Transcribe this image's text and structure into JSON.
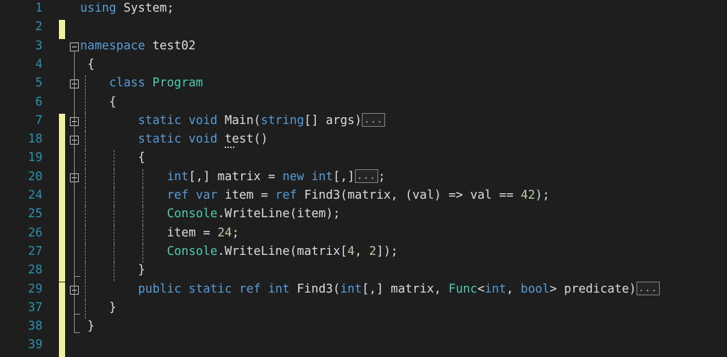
{
  "editor": {
    "language": "csharp",
    "background_color": "#1e1e1e",
    "line_number_color": "#2b91af",
    "change_bar_color": "#eef09a",
    "keyword_color": "#569cd6",
    "type_color": "#4ec9b0",
    "number_color": "#b5cea8",
    "text_color": "#dcdcdc",
    "collapsed_placeholder": "..."
  },
  "lines": [
    {
      "number": "1",
      "changed": false,
      "fold": "none",
      "indent_guides": 0,
      "tokens": [
        {
          "t": "using",
          "c": "kw"
        },
        {
          "t": " ",
          "c": "punc"
        },
        {
          "t": "System",
          "c": "id"
        },
        {
          "t": ";",
          "c": "punc"
        }
      ],
      "text": "using System;"
    },
    {
      "number": "2",
      "changed": true,
      "fold": "none",
      "indent_guides": 0,
      "tokens": [],
      "text": ""
    },
    {
      "number": "3",
      "changed": false,
      "fold": "minus",
      "indent_guides": 0,
      "tokens": [
        {
          "t": "namespace",
          "c": "kw"
        },
        {
          "t": " ",
          "c": "punc"
        },
        {
          "t": "test02",
          "c": "id"
        }
      ],
      "text": "namespace test02"
    },
    {
      "number": "4",
      "changed": false,
      "fold": "none",
      "indent_guides": 0,
      "tokens": [
        {
          "t": "{",
          "c": "punc"
        }
      ],
      "text": "{"
    },
    {
      "number": "5",
      "changed": false,
      "fold": "minus",
      "indent_guides": 1,
      "tokens": [
        {
          "t": "class",
          "c": "kw"
        },
        {
          "t": " ",
          "c": "punc"
        },
        {
          "t": "Program",
          "c": "typ"
        }
      ],
      "text": "class Program"
    },
    {
      "number": "6",
      "changed": false,
      "fold": "none",
      "indent_guides": 1,
      "tokens": [
        {
          "t": "{",
          "c": "punc"
        }
      ],
      "text": "{"
    },
    {
      "number": "7",
      "changed": true,
      "fold": "plus",
      "indent_guides": 1,
      "collapsed": true,
      "tokens": [
        {
          "t": "static",
          "c": "kw"
        },
        {
          "t": " ",
          "c": "punc"
        },
        {
          "t": "void",
          "c": "kw"
        },
        {
          "t": " ",
          "c": "punc"
        },
        {
          "t": "Main",
          "c": "id"
        },
        {
          "t": "(",
          "c": "punc"
        },
        {
          "t": "string",
          "c": "kw"
        },
        {
          "t": "[] ",
          "c": "punc"
        },
        {
          "t": "args",
          "c": "id"
        },
        {
          "t": ")",
          "c": "punc"
        }
      ],
      "text": "static void Main(string[] args)"
    },
    {
      "number": "18",
      "changed": true,
      "fold": "minus",
      "indent_guides": 1,
      "rename_hint": true,
      "tokens": [
        {
          "t": "static",
          "c": "kw"
        },
        {
          "t": " ",
          "c": "punc"
        },
        {
          "t": "void",
          "c": "kw"
        },
        {
          "t": " ",
          "c": "punc"
        },
        {
          "t": "test",
          "c": "id"
        },
        {
          "t": "()",
          "c": "punc"
        }
      ],
      "text": "static void test()"
    },
    {
      "number": "19",
      "changed": true,
      "fold": "none",
      "indent_guides": 2,
      "tokens": [
        {
          "t": "{",
          "c": "punc"
        }
      ],
      "text": "{"
    },
    {
      "number": "20",
      "changed": true,
      "fold": "plus",
      "indent_guides": 3,
      "collapsed": true,
      "collapsed_suffix": ";",
      "tokens": [
        {
          "t": "int",
          "c": "kw"
        },
        {
          "t": "[,] ",
          "c": "punc"
        },
        {
          "t": "matrix",
          "c": "id"
        },
        {
          "t": " = ",
          "c": "punc"
        },
        {
          "t": "new",
          "c": "kw"
        },
        {
          "t": " ",
          "c": "punc"
        },
        {
          "t": "int",
          "c": "kw"
        },
        {
          "t": "[,]",
          "c": "punc"
        }
      ],
      "text": "int[,] matrix = new int[,]"
    },
    {
      "number": "24",
      "changed": true,
      "fold": "none",
      "indent_guides": 3,
      "tokens": [
        {
          "t": "ref",
          "c": "kw"
        },
        {
          "t": " ",
          "c": "punc"
        },
        {
          "t": "var",
          "c": "kw"
        },
        {
          "t": " ",
          "c": "punc"
        },
        {
          "t": "item",
          "c": "id"
        },
        {
          "t": " = ",
          "c": "punc"
        },
        {
          "t": "ref",
          "c": "kw"
        },
        {
          "t": " ",
          "c": "punc"
        },
        {
          "t": "Find3",
          "c": "id"
        },
        {
          "t": "(",
          "c": "punc"
        },
        {
          "t": "matrix",
          "c": "id"
        },
        {
          "t": ", (",
          "c": "punc"
        },
        {
          "t": "val",
          "c": "id"
        },
        {
          "t": ") => ",
          "c": "punc"
        },
        {
          "t": "val",
          "c": "id"
        },
        {
          "t": " == ",
          "c": "punc"
        },
        {
          "t": "42",
          "c": "num"
        },
        {
          "t": ");",
          "c": "punc"
        }
      ],
      "text": "ref var item = ref Find3(matrix, (val) => val == 42);"
    },
    {
      "number": "25",
      "changed": true,
      "fold": "none",
      "indent_guides": 3,
      "tokens": [
        {
          "t": "Console",
          "c": "typ"
        },
        {
          "t": ".",
          "c": "punc"
        },
        {
          "t": "WriteLine",
          "c": "id"
        },
        {
          "t": "(",
          "c": "punc"
        },
        {
          "t": "item",
          "c": "id"
        },
        {
          "t": ");",
          "c": "punc"
        }
      ],
      "text": "Console.WriteLine(item);"
    },
    {
      "number": "26",
      "changed": true,
      "fold": "none",
      "indent_guides": 3,
      "tokens": [
        {
          "t": "item",
          "c": "id"
        },
        {
          "t": " = ",
          "c": "punc"
        },
        {
          "t": "24",
          "c": "num"
        },
        {
          "t": ";",
          "c": "punc"
        }
      ],
      "text": "item = 24;"
    },
    {
      "number": "27",
      "changed": true,
      "fold": "none",
      "indent_guides": 3,
      "tokens": [
        {
          "t": "Console",
          "c": "typ"
        },
        {
          "t": ".",
          "c": "punc"
        },
        {
          "t": "WriteLine",
          "c": "id"
        },
        {
          "t": "(",
          "c": "punc"
        },
        {
          "t": "matrix",
          "c": "id"
        },
        {
          "t": "[",
          "c": "punc"
        },
        {
          "t": "4",
          "c": "num"
        },
        {
          "t": ", ",
          "c": "punc"
        },
        {
          "t": "2",
          "c": "num"
        },
        {
          "t": "]);",
          "c": "punc"
        }
      ],
      "text": "Console.WriteLine(matrix[4, 2]);"
    },
    {
      "number": "28",
      "changed": true,
      "fold": "none",
      "indent_guides": 2,
      "tokens": [
        {
          "t": "}",
          "c": "punc"
        }
      ],
      "text": "}"
    },
    {
      "number": "29",
      "changed": true,
      "fold": "plus",
      "indent_guides": 1,
      "collapsed": true,
      "tokens": [
        {
          "t": "public",
          "c": "kw"
        },
        {
          "t": " ",
          "c": "punc"
        },
        {
          "t": "static",
          "c": "kw"
        },
        {
          "t": " ",
          "c": "punc"
        },
        {
          "t": "ref",
          "c": "kw"
        },
        {
          "t": " ",
          "c": "punc"
        },
        {
          "t": "int",
          "c": "kw"
        },
        {
          "t": " ",
          "c": "punc"
        },
        {
          "t": "Find3",
          "c": "id"
        },
        {
          "t": "(",
          "c": "punc"
        },
        {
          "t": "int",
          "c": "kw"
        },
        {
          "t": "[,] ",
          "c": "punc"
        },
        {
          "t": "matrix",
          "c": "id"
        },
        {
          "t": ", ",
          "c": "punc"
        },
        {
          "t": "Func",
          "c": "typ"
        },
        {
          "t": "<",
          "c": "punc"
        },
        {
          "t": "int",
          "c": "kw"
        },
        {
          "t": ", ",
          "c": "punc"
        },
        {
          "t": "bool",
          "c": "kw"
        },
        {
          "t": "> ",
          "c": "punc"
        },
        {
          "t": "predicate",
          "c": "id"
        },
        {
          "t": ")",
          "c": "punc"
        }
      ],
      "text": "public static ref int Find3(int[,] matrix, Func<int, bool> predicate)"
    },
    {
      "number": "37",
      "changed": true,
      "fold": "none",
      "indent_guides": 1,
      "tokens": [
        {
          "t": "}",
          "c": "punc"
        }
      ],
      "text": "}"
    },
    {
      "number": "38",
      "changed": true,
      "fold": "none",
      "indent_guides": 0,
      "tokens": [
        {
          "t": "}",
          "c": "punc"
        }
      ],
      "text": "}"
    },
    {
      "number": "39",
      "changed": true,
      "fold": "none",
      "indent_guides": 0,
      "tokens": [],
      "text": ""
    }
  ]
}
